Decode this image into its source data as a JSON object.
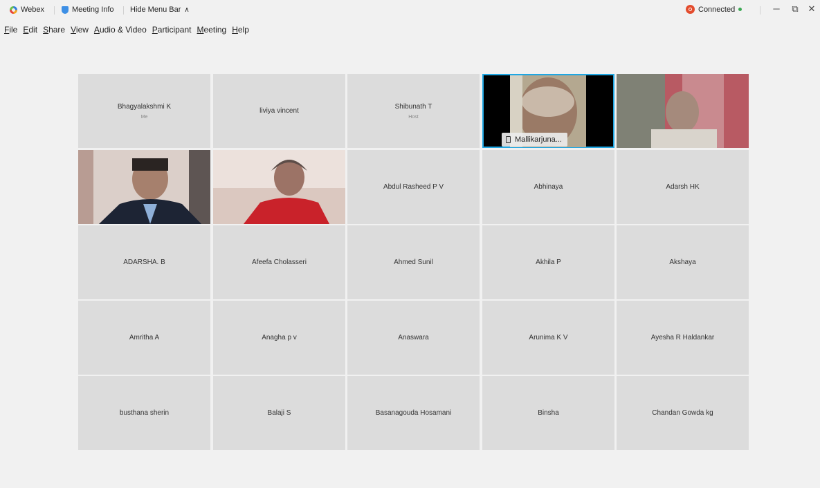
{
  "titlebar": {
    "app_name": "Webex",
    "meeting_info": "Meeting Info",
    "hide_menu": "Hide Menu Bar",
    "status": "Connected",
    "window_controls": [
      "minimize",
      "restore",
      "close"
    ]
  },
  "menu": [
    {
      "key": "F",
      "rest": "ile"
    },
    {
      "key": "E",
      "rest": "dit"
    },
    {
      "key": "S",
      "rest": "hare"
    },
    {
      "key": "V",
      "rest": "iew"
    },
    {
      "key": "A",
      "rest": "udio & Video"
    },
    {
      "key": "P",
      "rest": "articipant"
    },
    {
      "key": "M",
      "rest": "eeting"
    },
    {
      "key": "H",
      "rest": "elp"
    }
  ],
  "participants": [
    {
      "name": "Bhagyalakshmi K",
      "role": "Me"
    },
    {
      "name": "liviya vincent"
    },
    {
      "name": "Shibunath T",
      "role": "Host"
    },
    {
      "name": "Mallikarjuna...",
      "video": true,
      "speaking": true
    },
    {
      "name": "",
      "video": true
    },
    {
      "name": "",
      "video": true
    },
    {
      "name": "",
      "video": true
    },
    {
      "name": "Abdul Rasheed P V"
    },
    {
      "name": "Abhinaya"
    },
    {
      "name": "Adarsh HK"
    },
    {
      "name": "ADARSHA. B"
    },
    {
      "name": "Afeefa Cholasseri"
    },
    {
      "name": "Ahmed Sunil"
    },
    {
      "name": "Akhila P"
    },
    {
      "name": "Akshaya"
    },
    {
      "name": "Amritha A"
    },
    {
      "name": "Anagha p v"
    },
    {
      "name": "Anaswara"
    },
    {
      "name": "Arunima K V"
    },
    {
      "name": "Ayesha R Haldankar"
    },
    {
      "name": "busthana sherin"
    },
    {
      "name": "Balaji S"
    },
    {
      "name": "Basanagouda Hosamani"
    },
    {
      "name": "Binsha"
    },
    {
      "name": "Chandan Gowda kg"
    }
  ],
  "colors": {
    "accent": "#1fa7e3",
    "tile_bg": "#dcdcdc",
    "status_green": "#3aa852",
    "record_red": "#e34c2d"
  }
}
